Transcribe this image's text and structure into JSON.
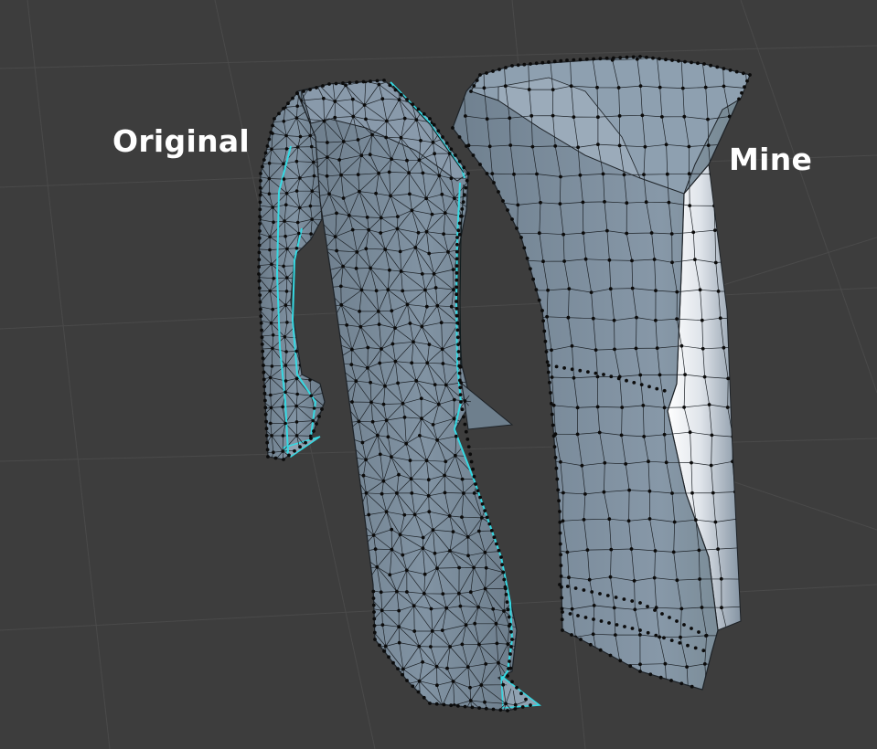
{
  "labels": {
    "original": "Original",
    "mine": "Mine"
  },
  "colors": {
    "background": "#3d3d3d",
    "grid": "#4a4a4a",
    "mesh_fill": "#7b8d9d",
    "mesh_wire": "#1d2227",
    "vertex": "#0b0b0b",
    "seam": "#35d9e3",
    "highlight": "#f2f4f6"
  }
}
